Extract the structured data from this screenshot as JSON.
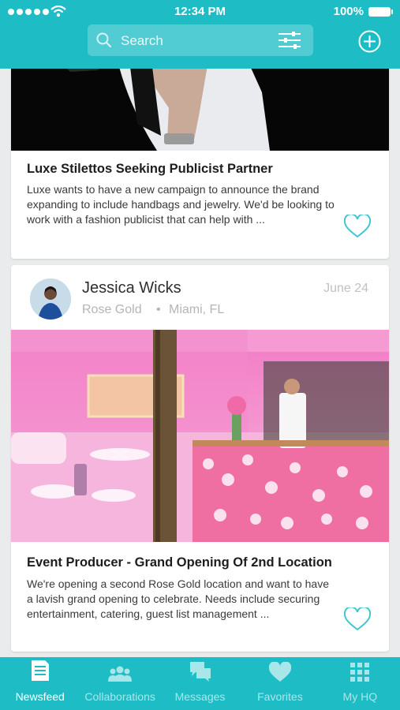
{
  "status": {
    "time": "12:34 PM",
    "battery": "100%"
  },
  "header": {
    "search_placeholder": "Search"
  },
  "posts": [
    {
      "title": "Luxe Stilettos Seeking Publicist Partner",
      "description": "Luxe wants to have a new campaign to announce the brand expanding to include handbags and jewelry. We'd be looking to work with a fashion publicist that can help with ..."
    },
    {
      "poster_name": "Jessica Wicks",
      "company": "Rose Gold",
      "separator": "•",
      "location": "Miami, FL",
      "date": "June 24",
      "title": "Event Producer - Grand Opening Of 2nd Location",
      "description": "We're opening a second Rose Gold location and want to have a lavish grand opening to celebrate. Needs include securing entertainment, catering, guest list management ..."
    }
  ],
  "tabs": [
    {
      "label": "Newsfeed",
      "icon": "newsfeed-icon",
      "active": true
    },
    {
      "label": "Collaborations",
      "icon": "collaborations-icon",
      "active": false
    },
    {
      "label": "Messages",
      "icon": "messages-icon",
      "active": false
    },
    {
      "label": "Favorites",
      "icon": "favorites-icon",
      "active": false
    },
    {
      "label": "My HQ",
      "icon": "grid-icon",
      "active": false
    }
  ],
  "colors": {
    "brand": "#1ebcc5",
    "heart": "#3fc6cf"
  }
}
